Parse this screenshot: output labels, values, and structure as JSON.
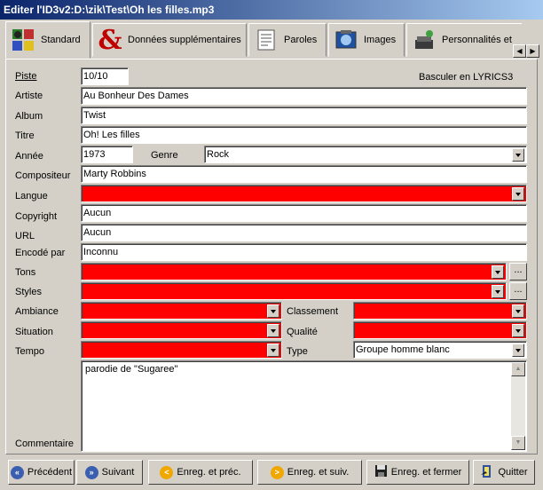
{
  "window": {
    "title": "Editer l'ID3v2:D:\\zik\\Test\\Oh les filles.mp3"
  },
  "tabs": [
    {
      "label": "Standard",
      "icon": "standard-icon"
    },
    {
      "label": "Données supplémentaires",
      "icon": "ampersand-icon"
    },
    {
      "label": "Paroles",
      "icon": "lyrics-icon"
    },
    {
      "label": "Images",
      "icon": "images-icon"
    },
    {
      "label": "Personnalités et",
      "icon": "people-icon"
    }
  ],
  "form": {
    "piste": {
      "label": "Piste",
      "value": "10/10"
    },
    "lyrics_toggle": "Basculer en LYRICS3",
    "artiste": {
      "label": "Artiste",
      "value": "Au Bonheur Des Dames"
    },
    "album": {
      "label": "Album",
      "value": "Twist"
    },
    "titre": {
      "label": "Titre",
      "value": "Oh! Les filles"
    },
    "annee": {
      "label": "Année",
      "value": "1973"
    },
    "genre": {
      "label": "Genre",
      "value": "Rock"
    },
    "compositeur": {
      "label": "Compositeur",
      "value": "Marty Robbins"
    },
    "langue": {
      "label": "Langue",
      "value": ""
    },
    "copyright": {
      "label": "Copyright",
      "value": "Aucun"
    },
    "url": {
      "label": "URL",
      "value": "Aucun"
    },
    "encode_par": {
      "label": "Encodé par",
      "value": "Inconnu"
    },
    "tons": {
      "label": "Tons",
      "value": ""
    },
    "styles": {
      "label": "Styles",
      "value": ""
    },
    "ambiance": {
      "label": "Ambiance",
      "value": ""
    },
    "classement": {
      "label": "Classement",
      "value": ""
    },
    "situation": {
      "label": "Situation",
      "value": ""
    },
    "qualite": {
      "label": "Qualité",
      "value": ""
    },
    "tempo": {
      "label": "Tempo",
      "value": ""
    },
    "type": {
      "label": "Type",
      "value": "Groupe homme blanc"
    },
    "commentaire": {
      "label": "Commentaire",
      "value": "parodie de \"Sugaree\""
    },
    "ellipsis": "...",
    "empty_color": "#ff0000"
  },
  "buttons": {
    "precedent": "Précédent",
    "suivant": "Suivant",
    "enreg_prec": "Enreg. et préc.",
    "enreg_suiv": "Enreg. et suiv.",
    "enreg_fermer": "Enreg. et fermer",
    "quitter": "Quitter"
  }
}
